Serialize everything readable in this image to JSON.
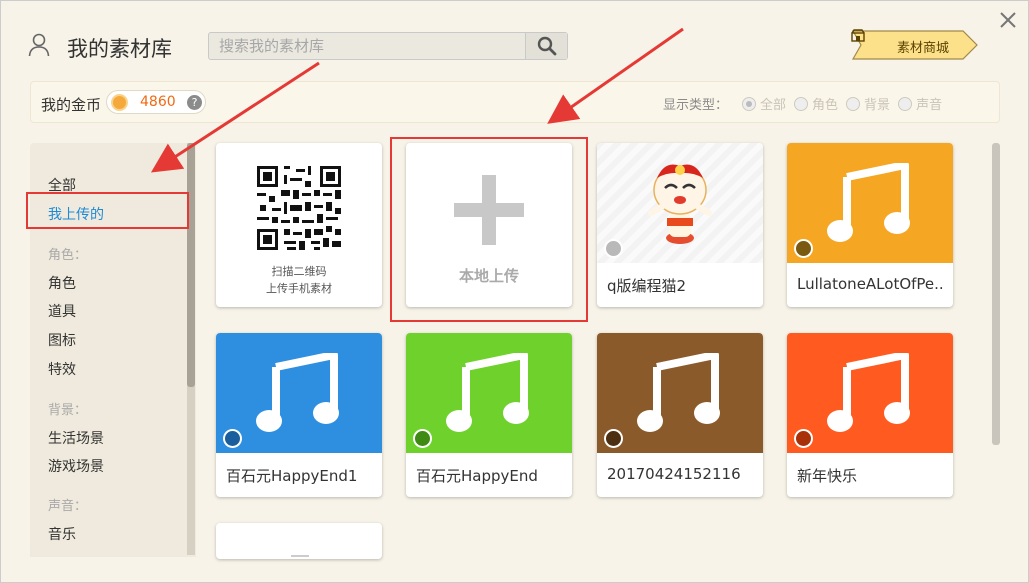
{
  "header": {
    "title": "我的素材库",
    "search_placeholder": "搜索我的素材库",
    "shop_label": "素材商城"
  },
  "coins": {
    "label": "我的金币",
    "value": "4860",
    "help": "?"
  },
  "filter": {
    "label": "显示类型：",
    "options": [
      "全部",
      "角色",
      "背景",
      "声音"
    ],
    "selected": "全部"
  },
  "sidebar": {
    "items": [
      {
        "label": "全部",
        "type": "item"
      },
      {
        "label": "我上传的",
        "type": "item",
        "active": true
      },
      {
        "label": "角色：",
        "type": "category"
      },
      {
        "label": "角色",
        "type": "item"
      },
      {
        "label": "道具",
        "type": "item"
      },
      {
        "label": "图标",
        "type": "item"
      },
      {
        "label": "特效",
        "type": "item"
      },
      {
        "label": "背景：",
        "type": "category"
      },
      {
        "label": "生活场景",
        "type": "item"
      },
      {
        "label": "游戏场景",
        "type": "item"
      },
      {
        "label": "声音：",
        "type": "category"
      },
      {
        "label": "音乐",
        "type": "item"
      }
    ]
  },
  "cards": {
    "qr": {
      "line1": "扫描二维码",
      "line2": "上传手机素材"
    },
    "upload": {
      "label": "本地上传"
    },
    "items": [
      {
        "name": "q版编程猫2",
        "kind": "character",
        "color": "#f0f0f0"
      },
      {
        "name": "LullatoneALotOfPe..",
        "kind": "music",
        "color": "#f5a623"
      },
      {
        "name": "百石元HappyEnd1",
        "kind": "music",
        "color": "#2e8fe0"
      },
      {
        "name": "百石元HappyEnd",
        "kind": "music",
        "color": "#6fd12c"
      },
      {
        "name": "20170424152116",
        "kind": "music",
        "color": "#8b5a2b"
      },
      {
        "name": "新年快乐",
        "kind": "music",
        "color": "#ff5a1f"
      }
    ]
  },
  "colors": {
    "accent_blue": "#1d8ad8",
    "coin_orange": "#f06a14",
    "annotation_red": "#e53935"
  }
}
